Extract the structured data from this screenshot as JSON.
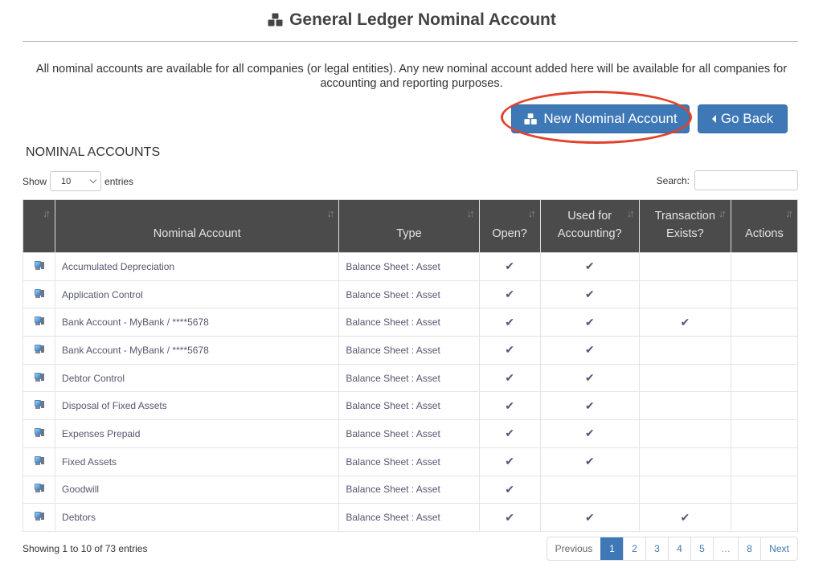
{
  "header": {
    "title": "General Ledger Nominal Account",
    "title_icon": "cubes-icon"
  },
  "intro_text": "All nominal accounts are available for all companies (or legal entities). Any new nominal account added here will be available for all companies for accounting and reporting purposes.",
  "actions": {
    "new_label": "New Nominal Account",
    "new_icon": "cubes-icon",
    "back_label": "Go Back",
    "back_icon": "caret-left-icon",
    "highlight_color": "#e2412b"
  },
  "section_title": "NOMINAL ACCOUNTS",
  "length": {
    "show_label": "Show",
    "value": "10",
    "entries_label": "entries"
  },
  "search": {
    "label": "Search:",
    "value": "",
    "placeholder": ""
  },
  "table": {
    "columns": [
      "",
      "Nominal Account",
      "Type",
      "Open?",
      "Used for Accounting?",
      "Transaction Exists?",
      "Actions"
    ],
    "column_lines": [
      [
        ""
      ],
      [
        "Nominal Account"
      ],
      [
        "Type"
      ],
      [
        "Open?"
      ],
      [
        "Used for",
        "Accounting?"
      ],
      [
        "Transaction",
        "Exists?"
      ],
      [
        "Actions"
      ]
    ],
    "check_glyph": "✔",
    "rows": [
      {
        "icon": "computer-icon",
        "name": "Accumulated Depreciation",
        "type": "Balance Sheet : Asset",
        "open": true,
        "used": true,
        "txn": false,
        "actions": ""
      },
      {
        "icon": "computer-icon",
        "name": "Application Control",
        "type": "Balance Sheet : Asset",
        "open": true,
        "used": true,
        "txn": false,
        "actions": ""
      },
      {
        "icon": "computer-icon",
        "name": "Bank Account - MyBank / ****5678",
        "type": "Balance Sheet : Asset",
        "open": true,
        "used": true,
        "txn": true,
        "actions": ""
      },
      {
        "icon": "computer-icon",
        "name": "Bank Account - MyBank / ****5678",
        "type": "Balance Sheet : Asset",
        "open": true,
        "used": true,
        "txn": false,
        "actions": ""
      },
      {
        "icon": "computer-icon",
        "name": "Debtor Control",
        "type": "Balance Sheet : Asset",
        "open": true,
        "used": true,
        "txn": false,
        "actions": ""
      },
      {
        "icon": "computer-icon",
        "name": "Disposal of Fixed Assets",
        "type": "Balance Sheet : Asset",
        "open": true,
        "used": true,
        "txn": false,
        "actions": ""
      },
      {
        "icon": "computer-icon",
        "name": "Expenses Prepaid",
        "type": "Balance Sheet : Asset",
        "open": true,
        "used": true,
        "txn": false,
        "actions": ""
      },
      {
        "icon": "computer-icon",
        "name": "Fixed Assets",
        "type": "Balance Sheet : Asset",
        "open": true,
        "used": true,
        "txn": false,
        "actions": ""
      },
      {
        "icon": "computer-icon",
        "name": "Goodwill",
        "type": "Balance Sheet : Asset",
        "open": true,
        "used": false,
        "txn": false,
        "actions": ""
      },
      {
        "icon": "computer-icon",
        "name": "Debtors",
        "type": "Balance Sheet : Asset",
        "open": true,
        "used": true,
        "txn": true,
        "actions": ""
      }
    ]
  },
  "footer": {
    "info": "Showing 1 to 10 of 73 entries",
    "pagination": {
      "previous": "Previous",
      "pages": [
        "1",
        "2",
        "3",
        "4",
        "5",
        "…",
        "8"
      ],
      "active": "1",
      "next": "Next"
    }
  },
  "colors": {
    "primary": "#3f78b6",
    "header_bg": "#4b4b4b"
  }
}
